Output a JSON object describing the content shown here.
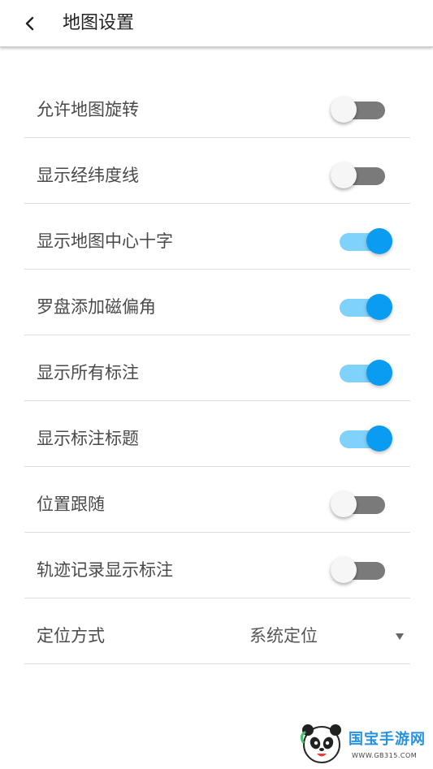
{
  "header": {
    "title": "地图设置",
    "back_icon": "back-arrow-icon"
  },
  "settings": [
    {
      "label": "允许地图旋转",
      "type": "toggle",
      "enabled": false
    },
    {
      "label": "显示经纬度线",
      "type": "toggle",
      "enabled": false
    },
    {
      "label": "显示地图中心十字",
      "type": "toggle",
      "enabled": true
    },
    {
      "label": "罗盘添加磁偏角",
      "type": "toggle",
      "enabled": true
    },
    {
      "label": "显示所有标注",
      "type": "toggle",
      "enabled": true
    },
    {
      "label": "显示标注标题",
      "type": "toggle",
      "enabled": true
    },
    {
      "label": "位置跟随",
      "type": "toggle",
      "enabled": false
    },
    {
      "label": "轨迹记录显示标注",
      "type": "toggle",
      "enabled": false
    },
    {
      "label": "定位方式",
      "type": "select",
      "value": "系统定位"
    }
  ],
  "colors": {
    "toggle_on_thumb": "#0a9cf0",
    "toggle_on_track": "#7fd2fb",
    "toggle_off_track": "#7a7a7a",
    "toggle_off_thumb": "#f6f6f6"
  },
  "watermark": {
    "brand": "国宝手游网",
    "url": "WWW.GB315.COM"
  }
}
